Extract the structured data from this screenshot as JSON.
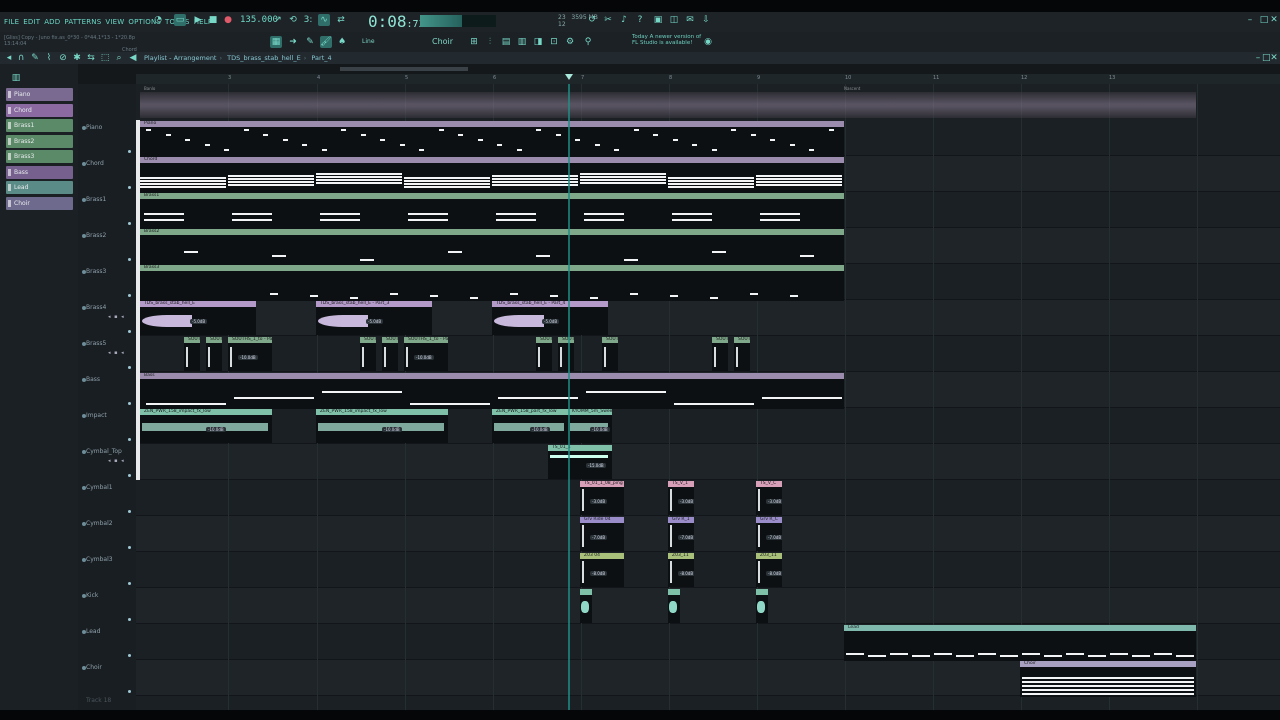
{
  "menu": [
    "FILE",
    "EDIT",
    "ADD",
    "PATTERNS",
    "VIEW",
    "OPTIONS",
    "TOOLS",
    "HELP"
  ],
  "transport": {
    "tempo": "135.000",
    "time": "0:08",
    "time_ms": ":73",
    "memory": "3595 MB",
    "cpu_label": "23",
    "poly": "12",
    "cpu_fraction": 0.55
  },
  "hint": {
    "line1": "[Gliss] Copy - Juno fix.as_0*30 - 0*44,1*13 - 1*20.8p",
    "line2": "13:14:04",
    "line3": "Chord"
  },
  "toolbar2": {
    "snap": "Line",
    "pattern": "Choir"
  },
  "news": {
    "line1": "Today  A newer version of",
    "line2": "FL Studio is available!"
  },
  "breadcrumb": [
    "Playlist - Arrangement",
    "TDS_brass_stab_hell_E",
    "Part_4"
  ],
  "picker": [
    {
      "label": "Piano",
      "color": "#7a6a92"
    },
    {
      "label": "Chord",
      "color": "#8a6aa0"
    },
    {
      "label": "Brass1",
      "color": "#5b8a68"
    },
    {
      "label": "Brass2",
      "color": "#5b8a68"
    },
    {
      "label": "Brass3",
      "color": "#5b8a68"
    },
    {
      "label": "Bass",
      "color": "#75608e"
    },
    {
      "label": "Lead",
      "color": "#5a8b86"
    },
    {
      "label": "Choir",
      "color": "#6e6a8e"
    }
  ],
  "ruler": [
    "3",
    "4",
    "5",
    "6",
    "7",
    "8",
    "9",
    "10",
    "11",
    "12",
    "13"
  ],
  "reference_labels": {
    "left": "Banlo",
    "right": "Nascent"
  },
  "tracks": [
    {
      "name": "Piano"
    },
    {
      "name": "Chord"
    },
    {
      "name": "Brass1"
    },
    {
      "name": "Brass2"
    },
    {
      "name": "Brass3"
    },
    {
      "name": "Brass4"
    },
    {
      "name": "Brass5"
    },
    {
      "name": "Bass"
    },
    {
      "name": "Impact"
    },
    {
      "name": "Cymbal_Top"
    },
    {
      "name": "Cymbal1"
    },
    {
      "name": "Cymbal2"
    },
    {
      "name": "Cymbal3"
    },
    {
      "name": "Kick"
    },
    {
      "name": "Lead"
    },
    {
      "name": "Choir"
    }
  ],
  "track_extra": "Track 18",
  "clips": {
    "piano": "Piano",
    "chord": "Chord",
    "brass1": "Brass1",
    "brass2": "Brass2",
    "brass3": "Brass3",
    "brass4": [
      "TDS_brass_stab_hell_E",
      "TDS_brass_stab_hell_E - Part_3",
      "TDS_brass_stab_hell_E - Part_4"
    ],
    "brass4_gain": "-5.0dB",
    "brass5": [
      "SOUTHS_1, Part",
      "SOUTHS_1_to - Part",
      "SOUTHS_1"
    ],
    "brass5_gain": "-10.0dB",
    "bass": "Bass",
    "impact": [
      "ZEN_PWR_158_impact_fx_low",
      "ZEN_PWR_158_impact_fx_low",
      "ZEN_PWR_158_part_fx_low",
      "KYOMM_5m_Sweep_01"
    ],
    "impact_gain": "-10.0dB",
    "cymbal_top": "TS_01_1",
    "cymbal_top_gain": "-15.0dB",
    "cymbal1": [
      "TS_01_1_08_ping",
      "TS_V_1",
      "TS_V_C"
    ],
    "cymbal1_gain": "-3.0dB",
    "cymbal2": [
      "Grv Ride 04",
      "Grv R_1",
      "Grv R_C"
    ],
    "cymbal2_gain": "-7.0dB",
    "cymbal3": [
      "Z03 04",
      "Z03_11",
      "Z03_11"
    ],
    "cymbal3_gain": "-8.0dB",
    "lead": "Lead",
    "choir": "Choir"
  }
}
